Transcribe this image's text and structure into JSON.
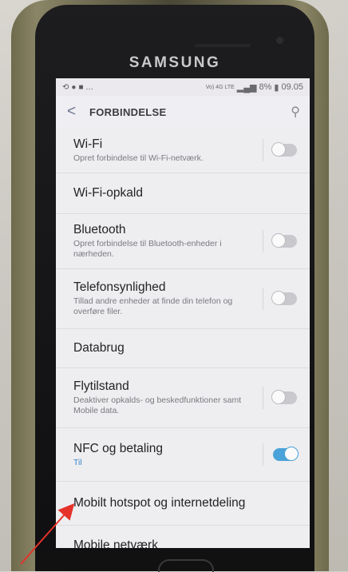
{
  "device": {
    "brand": "SAMSUNG"
  },
  "statusbar": {
    "left_icons": [
      "sync-icon",
      "circle-icon",
      "bag-icon"
    ],
    "ellipsis": "...",
    "network": "Vo) 4G LTE",
    "battery": "8%",
    "time": "09.05"
  },
  "appbar": {
    "title": "FORBINDELSE"
  },
  "rows": [
    {
      "label": "Wi-Fi",
      "sub": "Opret forbindelse til Wi-Fi-netværk.",
      "toggle": "off"
    },
    {
      "label": "Wi-Fi-opkald",
      "sub": ""
    },
    {
      "label": "Bluetooth",
      "sub": "Opret forbindelse til Bluetooth-enheder i nærheden.",
      "toggle": "off"
    },
    {
      "label": "Telefonsynlighed",
      "sub": "Tillad andre enheder at finde din telefon og overføre filer.",
      "toggle": "off"
    },
    {
      "label": "Databrug",
      "sub": ""
    },
    {
      "label": "Flytilstand",
      "sub": "Deaktiver opkalds- og beskedfunktioner samt Mobile data.",
      "toggle": "off"
    },
    {
      "label": "NFC og betaling",
      "sub": "Til",
      "toggle": "on"
    },
    {
      "label": "Mobilt hotspot og internetdeling",
      "sub": ""
    },
    {
      "label": "Mobile netværk",
      "sub": ""
    }
  ],
  "colors": {
    "toggle_on": "#4aa3d8",
    "arrow": "#e5322a",
    "sub_on": "#3a86c8"
  }
}
